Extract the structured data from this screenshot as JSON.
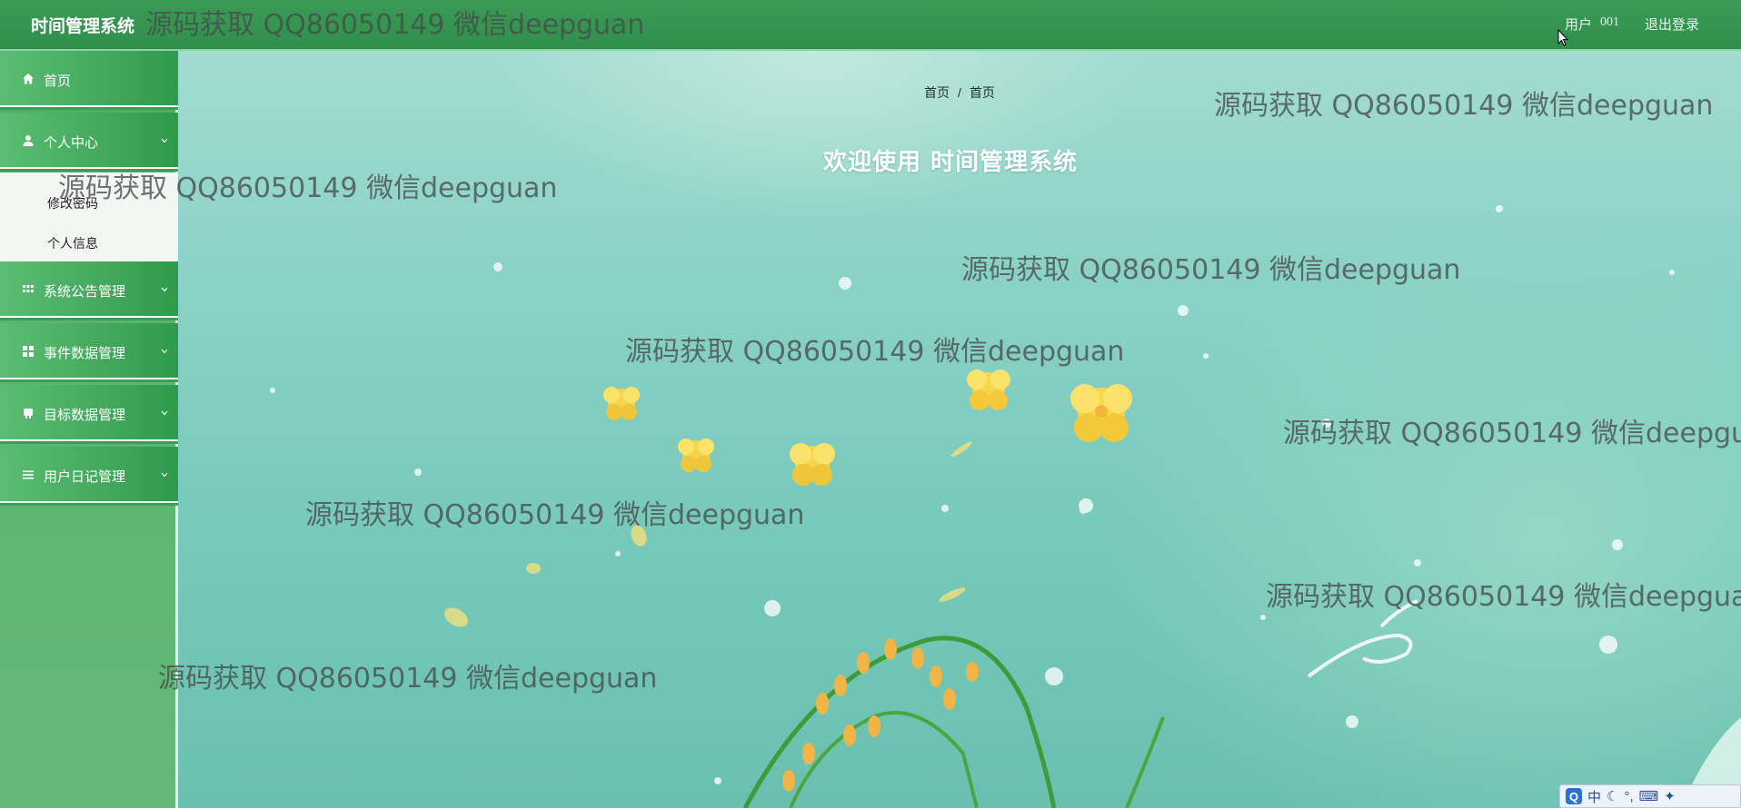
{
  "header": {
    "app_title": "时间管理系统",
    "user_label": "用户",
    "user_id": "001",
    "logout_label": "退出登录"
  },
  "sidebar": {
    "items": [
      {
        "label": "首页",
        "icon": "home-icon"
      },
      {
        "label": "个人中心",
        "icon": "person-icon"
      },
      {
        "label": "系统公告管理",
        "icon": "grid-icon"
      },
      {
        "label": "事件数据管理",
        "icon": "apps-icon"
      },
      {
        "label": "目标数据管理",
        "icon": "drum-icon"
      },
      {
        "label": "用户日记管理",
        "icon": "list-icon"
      }
    ],
    "submenu": [
      {
        "label": "修改密码"
      },
      {
        "label": "个人信息"
      }
    ]
  },
  "main": {
    "breadcrumb": [
      "首页",
      "/",
      "首页"
    ],
    "welcome": "欢迎使用 时间管理系统"
  },
  "watermark": "源码获取 QQ86050149 微信deepguan",
  "ime": {
    "logo": "Q",
    "mode": "中"
  },
  "colors": {
    "header_bg": "#2f8f4c",
    "sidebar_bg": "#4caf64",
    "menu_item_bg": "#3ea458",
    "background": "#8ad2c6",
    "accent_yellow": "#f5d64a"
  }
}
